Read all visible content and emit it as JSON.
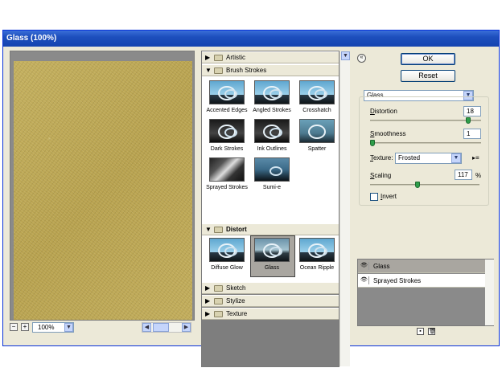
{
  "window": {
    "title": "Glass (100%)"
  },
  "preview": {
    "zoom": "100%",
    "zoom_out": "−",
    "zoom_in": "+"
  },
  "gallery": {
    "folders": {
      "artistic": "Artistic",
      "brush_strokes": "Brush Strokes",
      "distort": "Distort",
      "sketch": "Sketch",
      "stylize": "Stylize",
      "texture": "Texture"
    },
    "brush_strokes_filters": [
      "Accented Edges",
      "Angled Strokes",
      "Crosshatch",
      "Dark Strokes",
      "Ink Outlines",
      "Spatter",
      "Sprayed Strokes",
      "Sumi-e"
    ],
    "distort_filters": [
      "Diffuse Glow",
      "Glass",
      "Ocean Ripple"
    ],
    "selected_filter": "Glass"
  },
  "buttons": {
    "ok": "OK",
    "reset": "Reset"
  },
  "settings": {
    "filter": "Glass",
    "distortion_label": "Distortion",
    "distortion_value": "18",
    "distortion_level": 0.9,
    "smoothness_label": "Smoothness",
    "smoothness_value": "1",
    "smoothness_level": 0.0,
    "texture_label": "Texture:",
    "texture_value": "Frosted",
    "scaling_label": "Scaling",
    "scaling_value": "117",
    "scaling_unit": "%",
    "scaling_level": 0.43,
    "invert_label": "Invert",
    "invert_checked": false
  },
  "layers": [
    {
      "name": "Glass",
      "selected": true
    },
    {
      "name": "Sprayed Strokes",
      "selected": false
    }
  ]
}
